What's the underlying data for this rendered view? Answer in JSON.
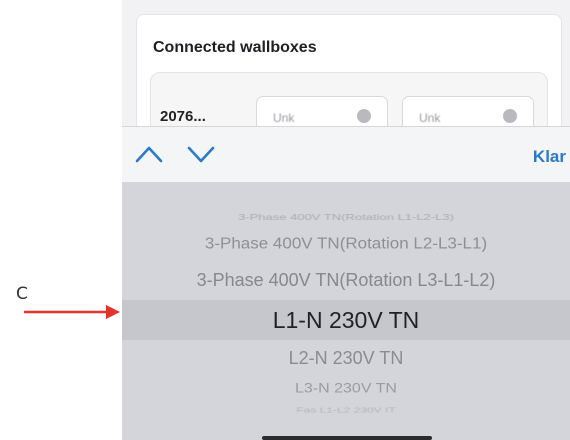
{
  "annotation": {
    "letter": "C",
    "arrow_color": "#e0342c"
  },
  "card": {
    "title": "Connected wallboxes",
    "wallbox_id": "2076...",
    "select_left_placeholder": "Unk",
    "select_right_placeholder": "Unk"
  },
  "toolbar": {
    "up_icon": "chevron-up-icon",
    "down_icon": "chevron-down-icon",
    "done_label": "Klar",
    "accent_color": "#2b79c9"
  },
  "picker": {
    "options": [
      "3-Phase 400V TN(Rotation L1-L2-L3)",
      "3-Phase 400V TN(Rotation L2-L3-L1)",
      "3-Phase 400V TN(Rotation L3-L1-L2)",
      "L1-N 230V TN",
      "L2-N 230V TN",
      "L3-N 230V TN",
      "Fas L1-L2 230V IT"
    ],
    "selected": "L1-N 230V TN"
  }
}
